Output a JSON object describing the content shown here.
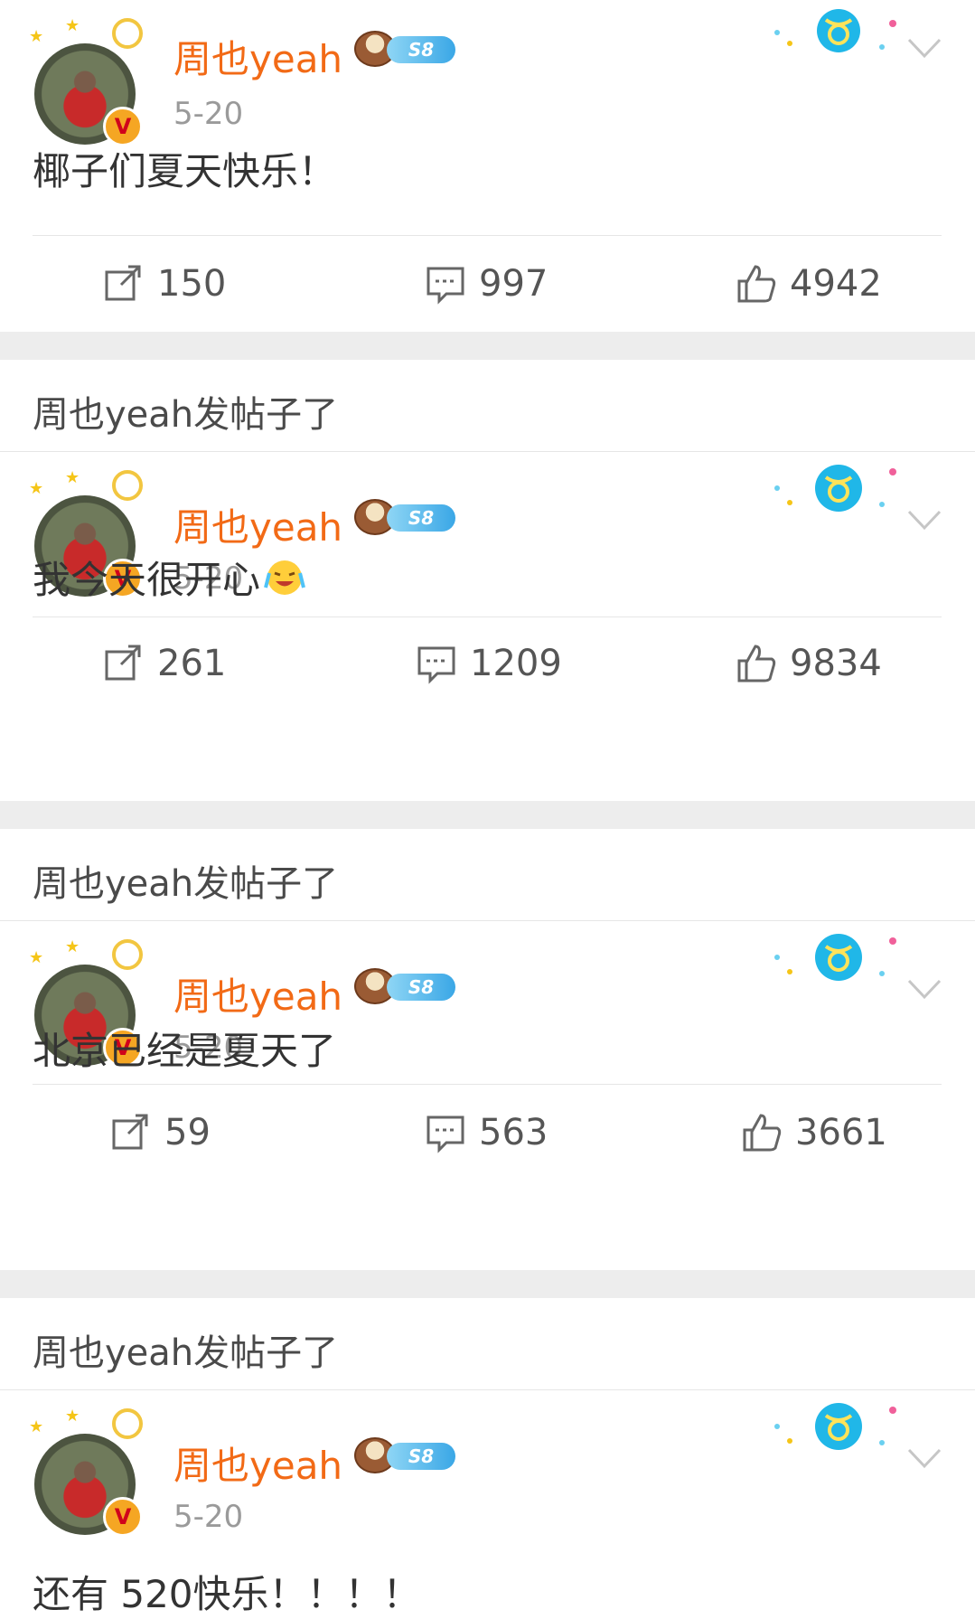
{
  "header_text": "周也yeah发帖子了",
  "posts": [
    {
      "username": "周也yeah",
      "level": "S8",
      "date": "5-20",
      "content": "椰子们夏天快乐！",
      "reposts": "150",
      "comments": "997",
      "likes": "4942"
    },
    {
      "username": "周也yeah",
      "level": "S8",
      "date": "5-20",
      "content": "我今天很开心",
      "reposts": "261",
      "comments": "1209",
      "likes": "9834"
    },
    {
      "username": "周也yeah",
      "level": "S8",
      "date": "5-20",
      "content": "北京已经是夏天了",
      "reposts": "59",
      "comments": "563",
      "likes": "3661"
    },
    {
      "username": "周也yeah",
      "level": "S8",
      "date": "5-20",
      "content": "还有 520快乐！！！！"
    }
  ],
  "colors": {
    "username": "#f26a16",
    "divider_gap": "#ededed",
    "date": "#9a9a9a"
  },
  "icons": [
    "repost-icon",
    "comment-icon",
    "like-icon",
    "chevron-down-icon",
    "verified-badge-icon",
    "taurus-sign-icon",
    "laughing-crying-emoji-icon"
  ]
}
